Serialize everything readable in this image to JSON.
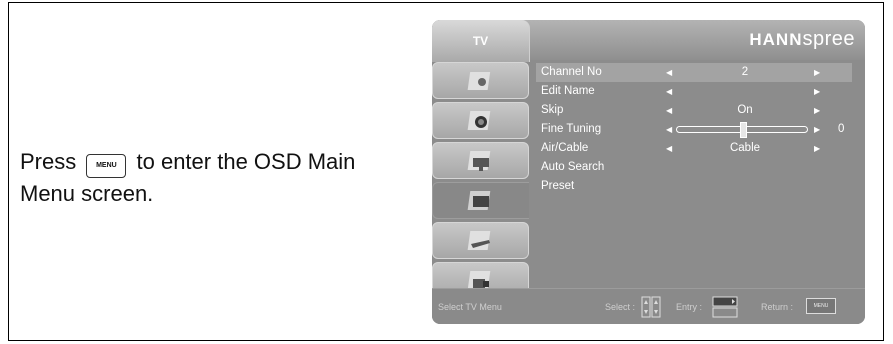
{
  "instruction": {
    "before": "Press",
    "key": "MENU",
    "after": "to enter the OSD Main Menu screen."
  },
  "osd": {
    "tab": "TV",
    "brand_bold": "HANN",
    "brand_light": "spree",
    "sidebar_icons": [
      "picture-icon",
      "audio-icon",
      "display-icon",
      "tv-icon",
      "tools-icon",
      "lock-icon"
    ],
    "rows": [
      {
        "label": "Channel No",
        "value": "2",
        "extra": ""
      },
      {
        "label": "Edit Name",
        "value": "",
        "extra": ""
      },
      {
        "label": "Skip",
        "value": "On",
        "extra": ""
      },
      {
        "label": "Fine Tuning",
        "value": "",
        "extra": "0"
      },
      {
        "label": "Air/Cable",
        "value": "Cable",
        "extra": ""
      },
      {
        "label": "Auto Search",
        "value": "",
        "extra": ""
      },
      {
        "label": "Preset",
        "value": "",
        "extra": ""
      }
    ],
    "fine_tuning_level": 0.5,
    "footer": {
      "hint": "Select TV Menu",
      "select": "Select :",
      "entry": "Entry :",
      "return": "Return :",
      "menu_key": "MENU"
    }
  }
}
